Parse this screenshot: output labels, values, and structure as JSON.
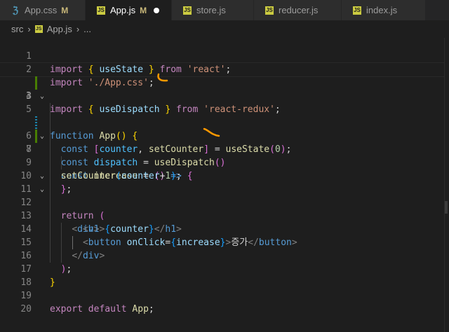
{
  "tabs": [
    {
      "icon": "css-file-icon",
      "label": "App.css",
      "badge": "M",
      "active": false
    },
    {
      "icon": "js-file-icon",
      "label": "App.js",
      "badge": "M",
      "active": true
    },
    {
      "icon": "js-file-icon",
      "label": "store.js",
      "badge": "",
      "active": false
    },
    {
      "icon": "js-file-icon",
      "label": "reducer.js",
      "badge": "",
      "active": false
    },
    {
      "icon": "js-file-icon",
      "label": "index.js",
      "badge": "",
      "active": false
    }
  ],
  "breadcrumb": {
    "folder": "src",
    "file": "App.js",
    "more": "..."
  },
  "js_icon_text": "JS",
  "line_numbers": [
    "1",
    "2",
    "3",
    "4",
    "5",
    "6",
    "7",
    "8",
    "9",
    "10",
    "11",
    "12",
    "13",
    "14",
    "15",
    "16",
    "17",
    "18",
    "19",
    "20"
  ],
  "code": {
    "l1": [
      "import",
      "{",
      "useState",
      "}",
      "from",
      "'react'",
      ";"
    ],
    "l2": [
      "import",
      "'./App.css'",
      ";"
    ],
    "l3": [
      "import",
      "{",
      "useDispatch",
      "}",
      "from",
      "'react-redux'",
      ";"
    ],
    "l5": [
      "function",
      "App",
      "()",
      "{"
    ],
    "l6": [
      "const",
      "[",
      "counter",
      ", ",
      "setCounter",
      "]",
      " = ",
      "useState",
      "(",
      "0",
      ")",
      ";"
    ],
    "l7": [
      "const",
      "dispatch",
      " = ",
      "useDispatch",
      "()"
    ],
    "l8": [
      "const",
      "increase",
      " = ",
      "()",
      " => ",
      "{"
    ],
    "l9": [
      "setCounter",
      "(",
      "counter",
      "+",
      "1",
      ")",
      ";"
    ],
    "l10": [
      "}",
      ";"
    ],
    "l11": [
      "return",
      "("
    ],
    "l12": [
      "<",
      "div",
      ">"
    ],
    "l13": [
      "<",
      "h1",
      ">",
      "{",
      "counter",
      "}",
      "</",
      "h1",
      ">"
    ],
    "l14": [
      "<",
      "button",
      " ",
      "onClick",
      "=",
      "{",
      "increase",
      "}",
      ">",
      "증가",
      "</",
      "button",
      ">"
    ],
    "l15": [
      "</",
      "div",
      ">"
    ],
    "l16": [
      ")",
      ";"
    ],
    "l17": [
      "}"
    ],
    "l19": [
      "export",
      "default",
      "App",
      ";"
    ]
  },
  "colors": {
    "annotation": "#ff9900",
    "modified": "#487e02",
    "keyword": "#569cd6",
    "control": "#c586c0"
  }
}
